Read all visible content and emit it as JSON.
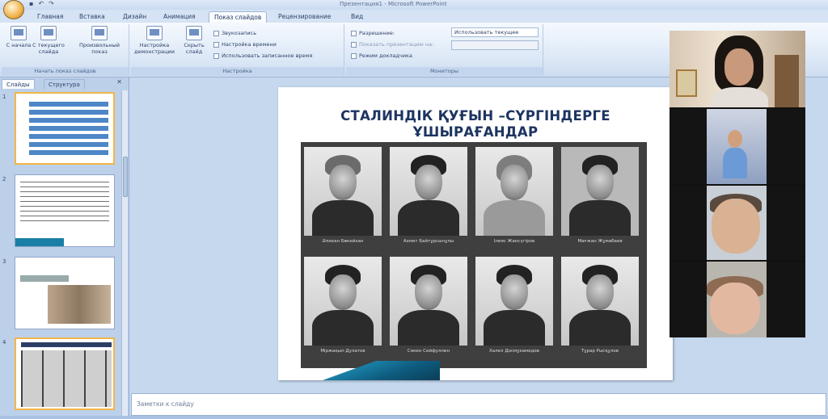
{
  "window": {
    "title": "Презентация1 - Microsoft PowerPoint"
  },
  "quick_access": {
    "save_icon": "save-icon",
    "undo_icon": "undo-icon",
    "redo_icon": "redo-icon"
  },
  "ribbon_tabs": [
    "Главная",
    "Вставка",
    "Дизайн",
    "Анимация",
    "Показ слайдов",
    "Рецензирование",
    "Вид"
  ],
  "ribbon_active_tab": "Показ слайдов",
  "ribbon": {
    "group_start": {
      "label": "Начать показ слайдов",
      "buttons": [
        "С начала",
        "С текущего слайда",
        "Произвольный показ"
      ]
    },
    "group_setup": {
      "label": "Настройка",
      "buttons": [
        "Настройка демонстрации",
        "Скрыть слайд"
      ],
      "options": [
        "Звукозапись",
        "Настройка времени",
        "Использовать записанное время"
      ]
    },
    "group_monitors": {
      "label": "Мониторы",
      "options": [
        "Разрешение:",
        "Показать презентацию на:",
        "Режим докладчика"
      ],
      "resolution_value": "Использовать текущее"
    }
  },
  "slide_panel": {
    "tabs": [
      "Слайды",
      "Структура"
    ],
    "active_tab": "Слайды",
    "close_icon": "close-icon",
    "slide_numbers": [
      "1",
      "2",
      "3",
      "4"
    ]
  },
  "slide": {
    "title": "СТАЛИНДІК ҚУҒЫН –СҮРГІНДЕРГЕ ҰШЫРАҒАНДАР",
    "captions": [
      "Әлихан Бөкейхан",
      "Ахмет Байтұрсынұлы",
      "Ілияс Жансүгіров",
      "Мағжан Жұмабаев",
      "Міржақып Дулатов",
      "Сәкен Сейфуллин",
      "Халел Досмұхамедов",
      "Тұрар Рысқұлов"
    ]
  },
  "notes": {
    "placeholder": "Заметки к слайду"
  },
  "colors": {
    "title_blue": "#1d3461",
    "ribbon_bg": "#dbe7f6",
    "selected_thumb": "#f2b648",
    "stage_bg": "#c5d8ee"
  }
}
